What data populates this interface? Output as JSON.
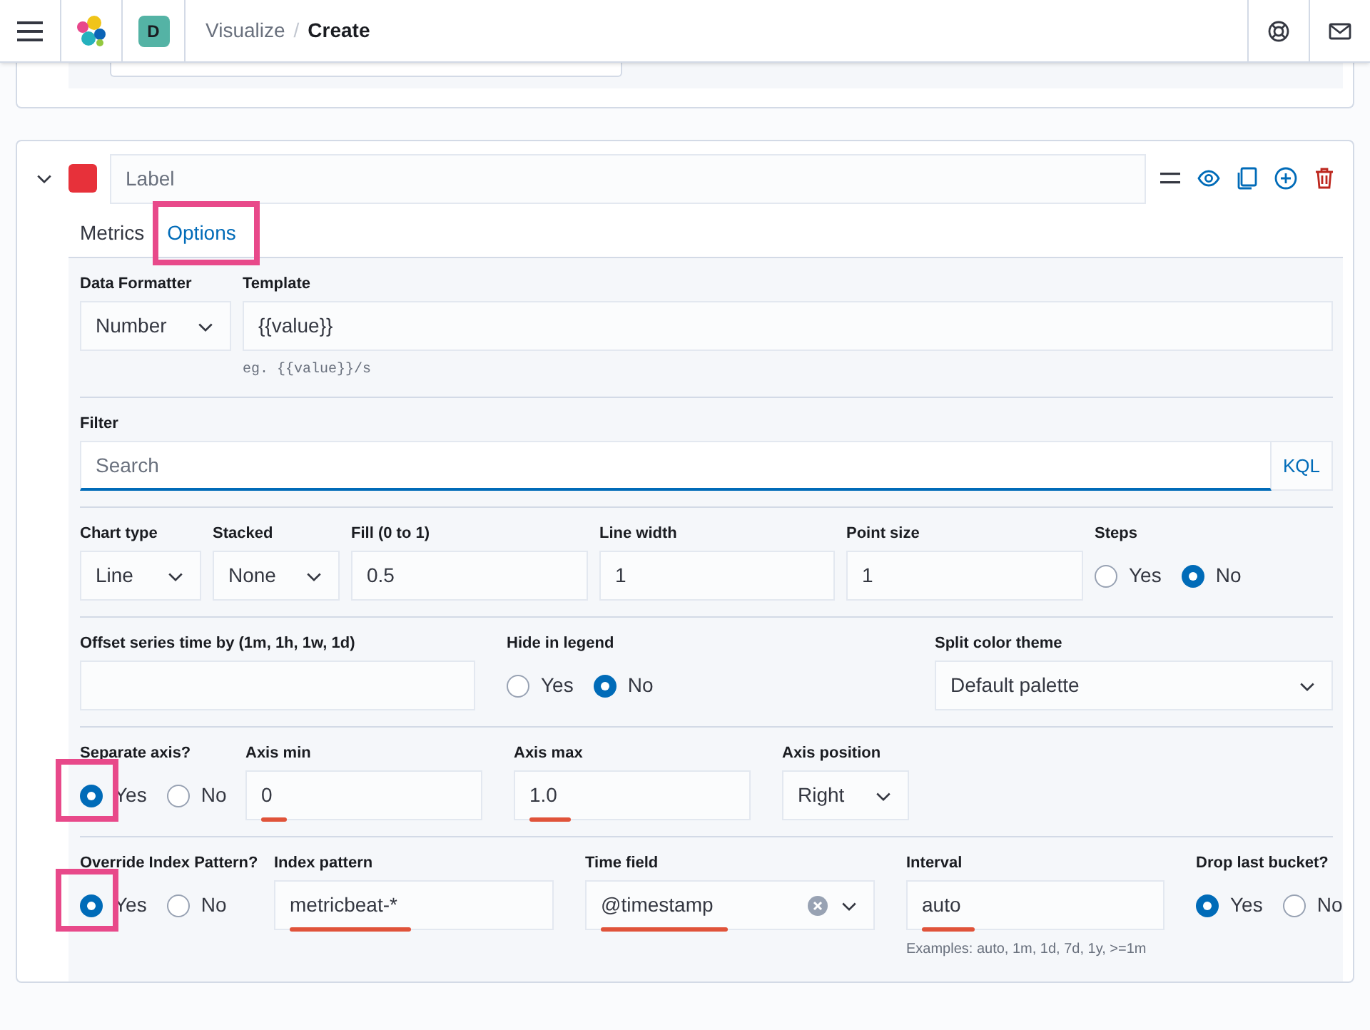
{
  "header": {
    "space_avatar": "D",
    "breadcrumb_separator": "/",
    "breadcrumbs": [
      {
        "label": "Visualize",
        "current": false
      },
      {
        "label": "Create",
        "current": true
      }
    ]
  },
  "series": {
    "expanded": true,
    "color": "#e7313a",
    "label_placeholder": "Label"
  },
  "tabs": [
    {
      "label": "Metrics",
      "selected": false
    },
    {
      "label": "Options",
      "selected": true,
      "highlighted": true
    }
  ],
  "rows": [
    [
      {
        "kind": "select",
        "label": "Data Formatter",
        "value": "Number"
      },
      {
        "kind": "input",
        "label": "Template",
        "value": "{{value}}",
        "hint": "eg. {{value}}/s"
      }
    ],
    [
      {
        "kind": "search",
        "label": "Filter",
        "placeholder": "Search",
        "button": "KQL"
      }
    ],
    [
      {
        "kind": "select",
        "label": "Chart type",
        "value": "Line"
      },
      {
        "kind": "select",
        "label": "Stacked",
        "value": "None"
      },
      {
        "kind": "input",
        "label": "Fill (0 to 1)",
        "value": "0.5"
      },
      {
        "kind": "input",
        "label": "Line width",
        "value": "1"
      },
      {
        "kind": "input",
        "label": "Point size",
        "value": "1"
      },
      {
        "kind": "radio",
        "label": "Steps",
        "options": [
          {
            "label": "Yes",
            "selected": false
          },
          {
            "label": "No",
            "selected": true
          }
        ]
      }
    ],
    [
      {
        "kind": "input",
        "label": "Offset series time by (1m, 1h, 1w, 1d)"
      },
      {
        "kind": "radio",
        "label": "Hide in legend",
        "options": [
          {
            "label": "Yes",
            "selected": false
          },
          {
            "label": "No",
            "selected": true
          }
        ]
      },
      {
        "kind": "select",
        "label": "Split color theme",
        "value": "Default palette"
      }
    ],
    [
      {
        "kind": "radio",
        "label": "Separate axis?",
        "options": [
          {
            "label": "Yes",
            "selected": true,
            "highlighted": true
          },
          {
            "label": "No",
            "selected": false
          }
        ]
      },
      {
        "kind": "input",
        "label": "Axis min",
        "value": "0",
        "underlined": true
      },
      {
        "kind": "input",
        "label": "Axis max",
        "value": "1.0",
        "underlined": true
      },
      {
        "kind": "select",
        "label": "Axis position",
        "value": "Right"
      }
    ],
    [
      {
        "kind": "radio",
        "label": "Override Index Pattern?",
        "options": [
          {
            "label": "Yes",
            "selected": true,
            "highlighted": true
          },
          {
            "label": "No",
            "selected": false
          }
        ]
      },
      {
        "kind": "input",
        "label": "Index pattern",
        "value": "metricbeat-*",
        "underlined": true
      },
      {
        "kind": "combo",
        "label": "Time field",
        "value": "@timestamp",
        "underlined": true
      },
      {
        "kind": "input",
        "label": "Interval",
        "value": "auto",
        "underlined": true,
        "hint": "Examples: auto, 1m, 1d, 7d, 1y, >=1m"
      },
      {
        "kind": "radio",
        "label": "Drop last bucket?",
        "options": [
          {
            "label": "Yes",
            "selected": true
          },
          {
            "label": "No",
            "selected": false
          }
        ]
      }
    ]
  ]
}
